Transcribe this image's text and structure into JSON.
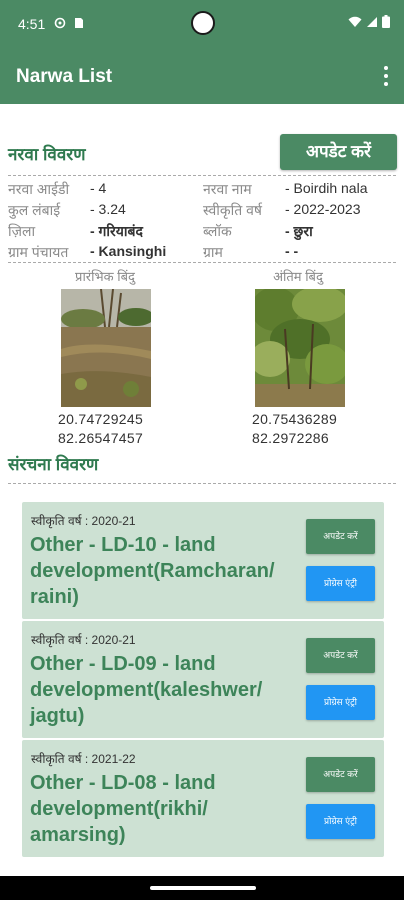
{
  "status": {
    "time": "4:51"
  },
  "appbar": {
    "title": "Narwa List"
  },
  "narwa": {
    "section_title": "नरवा विवरण",
    "update_label": "अपडेट करें",
    "fields": [
      {
        "key": "नरवा आईडी",
        "value": "- 4"
      },
      {
        "key": "नरवा नाम",
        "value": "- Boirdih nala"
      },
      {
        "key": "कुल लंबाई",
        "value": "- 3.24"
      },
      {
        "key": "स्वीकृति वर्ष",
        "value": "- 2022-2023"
      },
      {
        "key": "ज़िला",
        "value": "- गरियाबंद"
      },
      {
        "key": "ब्लॉक",
        "value": "- छुरा"
      },
      {
        "key": "ग्राम पंचायत",
        "value": "- Kansinghi"
      },
      {
        "key": "ग्राम",
        "value": "- -"
      }
    ],
    "start_point": {
      "label": "प्रारंभिक बिंदु",
      "lat": "20.74729245",
      "lng": "82.26547457"
    },
    "end_point": {
      "label": "अंतिम बिंदु",
      "lat": "20.75436289",
      "lng": "82.2972286"
    }
  },
  "structure": {
    "section_title": "संरचना विवरण",
    "items": [
      {
        "year": "स्वीकृति वर्ष : 2020-21",
        "name": "Other - LD-10 - land development(Ramcharan/ raini)",
        "update_label": "अपडेट करें",
        "progress_label": "प्रोग्रेस एंट्री"
      },
      {
        "year": "स्वीकृति वर्ष : 2020-21",
        "name": "Other - LD-09 - land development(kaleshwer/ jagtu)",
        "update_label": "अपडेट करें",
        "progress_label": "प्रोग्रेस एंट्री"
      },
      {
        "year": "स्वीकृति वर्ष : 2021-22",
        "name": "Other - LD-08 - land development(rikhi/ amarsing)",
        "update_label": "अपडेट करें",
        "progress_label": "प्रोग्रेस एंट्री"
      }
    ]
  },
  "colors": {
    "primary": "#4b8a64",
    "card_bg": "#cde1d3",
    "accent_blue": "#2196f3",
    "title_green": "#2f7a4f"
  }
}
